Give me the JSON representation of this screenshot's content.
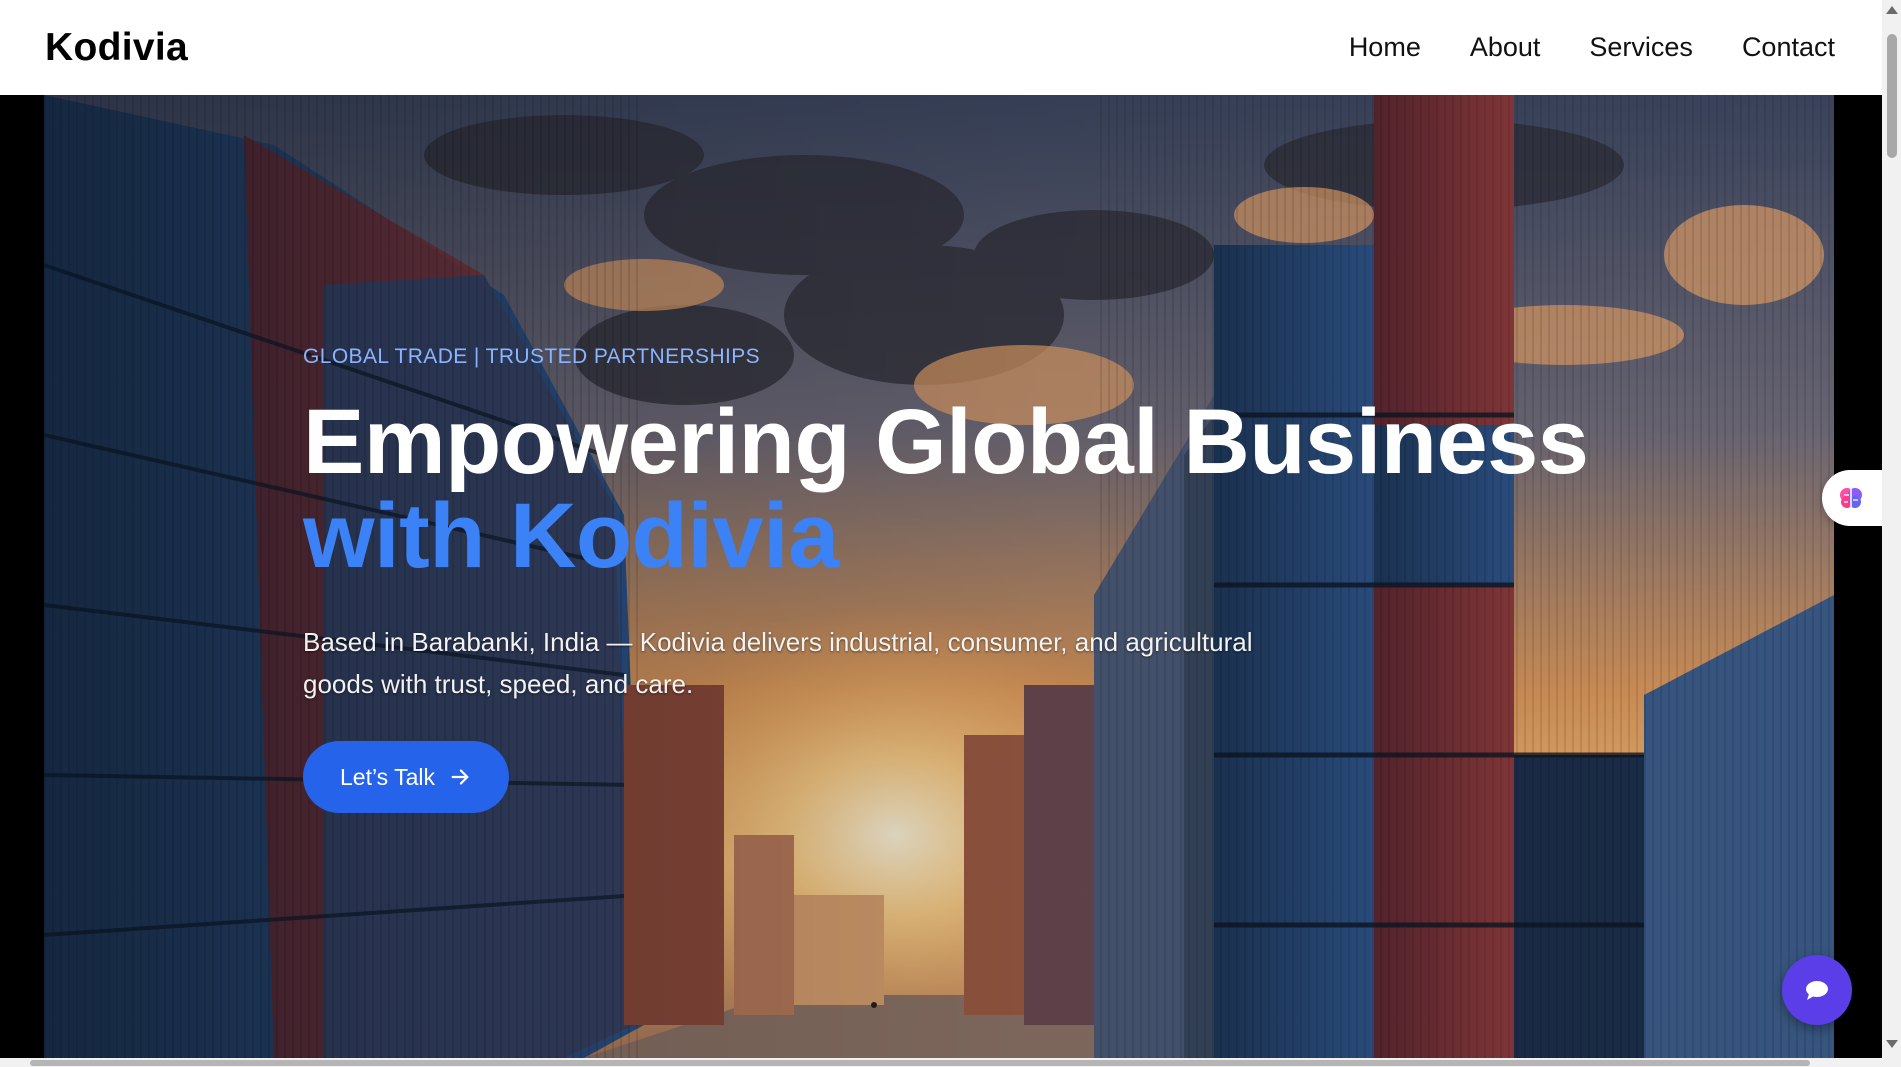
{
  "header": {
    "brand": "Kodivia",
    "nav": [
      {
        "label": "Home"
      },
      {
        "label": "About"
      },
      {
        "label": "Services"
      },
      {
        "label": "Contact"
      }
    ]
  },
  "hero": {
    "eyebrow": "GLOBAL TRADE | TRUSTED PARTNERSHIPS",
    "title_line1": "Empowering Global Business",
    "title_line2": "with Kodivia",
    "description": "Based in Barabanki, India — Kodivia delivers industrial, consumer, and agricultural goods with trust, speed, and care.",
    "cta_label": "Let’s Talk",
    "cta_icon": "arrow-right-icon",
    "background": "shipping-containers-sunset"
  },
  "widgets": {
    "side_tab_icon": "brain-icon",
    "chat_icon": "chat-bubble-icon"
  },
  "colors": {
    "accent": "#3b82f6",
    "eyebrow": "#8ab4ff",
    "button": "#2563eb",
    "chat_fab": "#5b3ee8"
  }
}
